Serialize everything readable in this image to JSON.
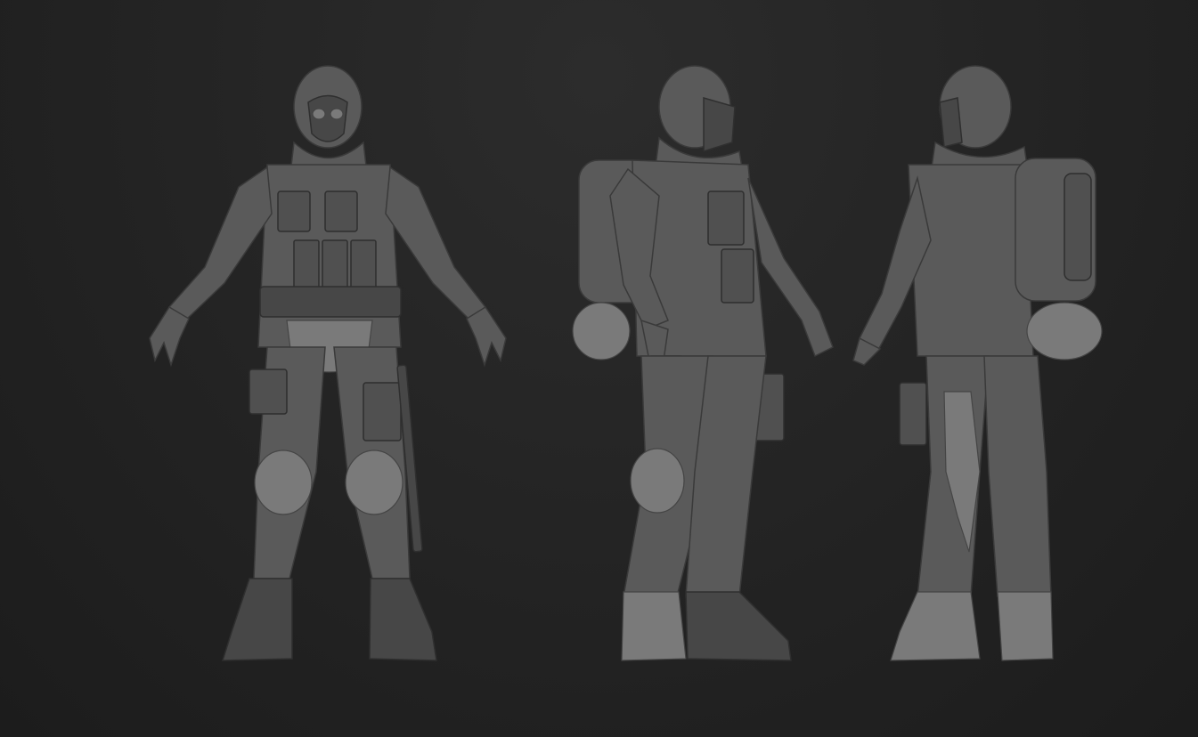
{
  "scene": {
    "background": "#232323",
    "views": [
      {
        "name": "front-view",
        "facing": "front"
      },
      {
        "name": "side-left-view",
        "facing": "three-quarter-left"
      },
      {
        "name": "back-right-view",
        "facing": "three-quarter-right"
      }
    ],
    "model_color": "#5a5a5a"
  }
}
